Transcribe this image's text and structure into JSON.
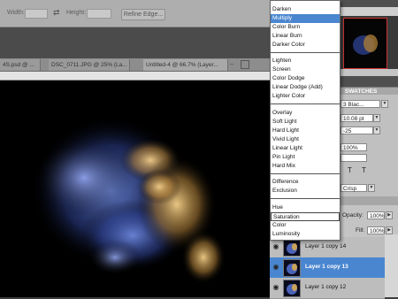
{
  "options_bar": {
    "width_label": "Width:",
    "height_label": "Height:",
    "swap_icon": "swap-arrows-icon",
    "refine_edge": "Refine Edge..."
  },
  "tabs": [
    {
      "label": "4S.psd @ ..."
    },
    {
      "label": "DSC_0711.JPG @ 25% (La..."
    },
    {
      "label": "Untitled-4 @ 66.7% (Layer..."
    }
  ],
  "blend_menu": {
    "groups": [
      [
        "Darken",
        "Multiply",
        "Color Burn",
        "Linear Burn",
        "Darker Color"
      ],
      [
        "Lighten",
        "Screen",
        "Color Dodge",
        "Linear Dodge (Add)",
        "Lighter Color"
      ],
      [
        "Overlay",
        "Soft Light",
        "Hard Light",
        "Vivid Light",
        "Linear Light",
        "Pin Light",
        "Hard Mix"
      ],
      [
        "Difference",
        "Exclusion"
      ],
      [
        "Hue",
        "Saturation",
        "Color",
        "Luminosity"
      ]
    ],
    "highlighted": "Multiply",
    "boxed": "Saturation"
  },
  "panels": {
    "swatches_label": "SWATCHES",
    "font_family": "3 Blac...",
    "font_size": "10.08 pt",
    "tracking": "-25",
    "scale": "100%",
    "antialias": "Crisp",
    "opacity_label": "Opacity:",
    "opacity_value": "100%",
    "fill_label": "Fill:",
    "fill_value": "100%"
  },
  "layers": [
    {
      "name": "Layer 1 copy 14",
      "selected": false
    },
    {
      "name": "Layer 1 copy 13",
      "selected": true
    },
    {
      "name": "Layer 1 copy 12",
      "selected": false
    }
  ],
  "colors": {
    "accent": "#4a86d0",
    "nav_border": "#cc3333"
  }
}
